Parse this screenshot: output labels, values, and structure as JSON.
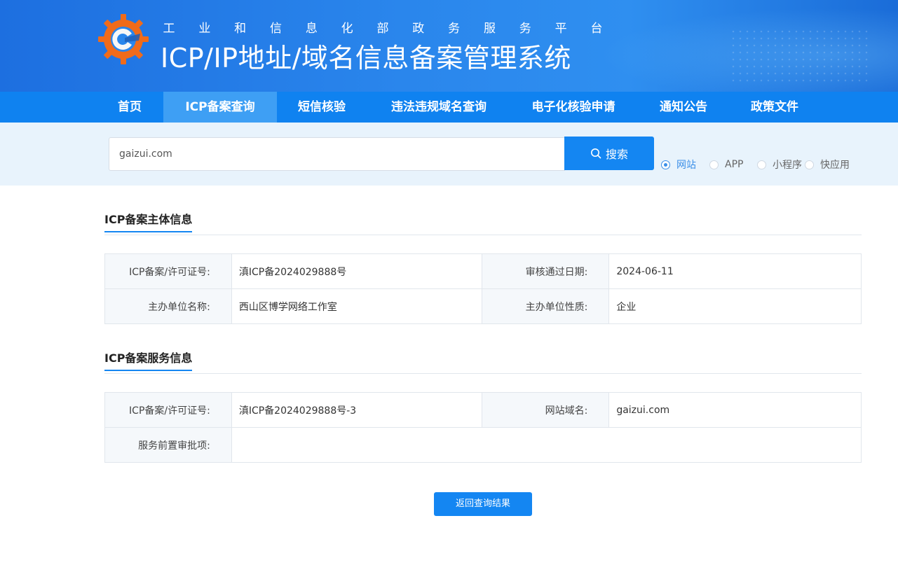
{
  "header": {
    "subtitle_chars": [
      "工",
      "业",
      "和",
      "信",
      "息",
      "化",
      "部",
      "政",
      "务",
      "服",
      "务",
      "平",
      "台"
    ],
    "title": "ICP/IP地址/域名信息备案管理系统"
  },
  "nav": {
    "items": [
      {
        "label": "首页"
      },
      {
        "label": "ICP备案查询",
        "active": true
      },
      {
        "label": "短信核验"
      },
      {
        "label": "违法违规域名查询"
      },
      {
        "label": "电子化核验申请"
      },
      {
        "label": "通知公告"
      },
      {
        "label": "政策文件"
      }
    ]
  },
  "search": {
    "value": "gaizui.com",
    "button_label": "搜索",
    "types": [
      {
        "label": "网站",
        "checked": true
      },
      {
        "label": "APP",
        "checked": false
      },
      {
        "label": "小程序",
        "checked": false
      },
      {
        "label": "快应用",
        "checked": false
      }
    ]
  },
  "subject_info": {
    "title": "ICP备案主体信息",
    "rows": [
      {
        "label1": "ICP备案/许可证号:",
        "value1": "滇ICP备2024029888号",
        "label2": "审核通过日期:",
        "value2": "2024-06-11"
      },
      {
        "label1": "主办单位名称:",
        "value1": "西山区博学网络工作室",
        "label2": "主办单位性质:",
        "value2": "企业"
      }
    ]
  },
  "service_info": {
    "title": "ICP备案服务信息",
    "row1": {
      "label1": "ICP备案/许可证号:",
      "value1": "滇ICP备2024029888号-3",
      "label2": "网站域名:",
      "value2": "gaizui.com"
    },
    "row2": {
      "label": "服务前置审批项:",
      "value": ""
    }
  },
  "back_button_label": "返回查询结果",
  "colors": {
    "primary": "#1486f2",
    "nav_active": "#3e9ff4",
    "search_band": "#e8f3fc",
    "logo_orange": "#f06b1a"
  }
}
